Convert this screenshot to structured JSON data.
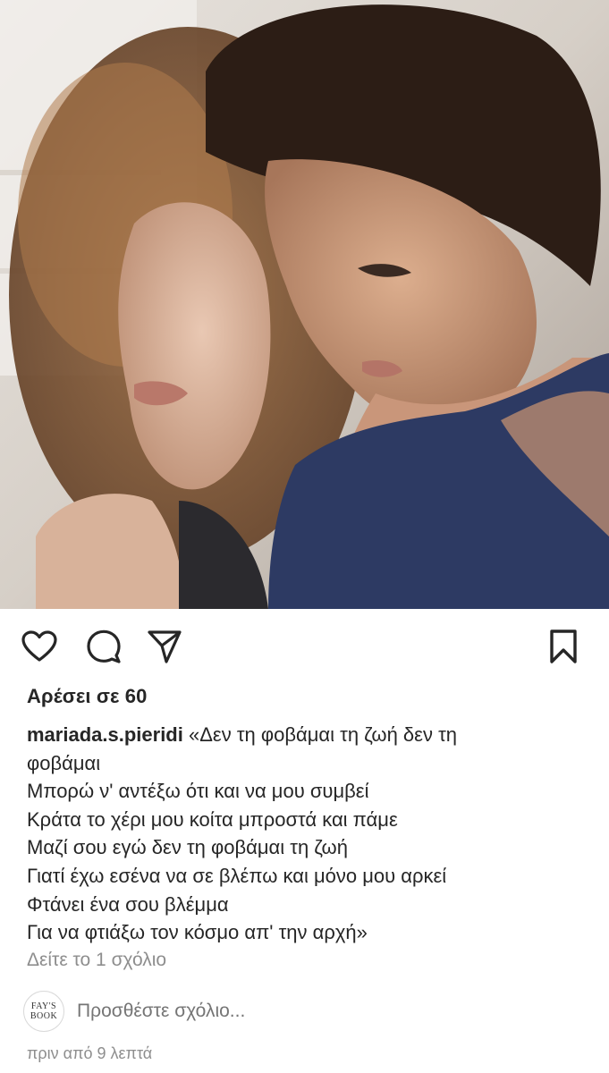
{
  "post": {
    "image_alt": "woman-and-boy-photo"
  },
  "actions": {
    "like_icon": "heart-icon",
    "comment_icon": "comment-bubble-icon",
    "share_icon": "paper-plane-icon",
    "save_icon": "bookmark-icon"
  },
  "likes": {
    "text": "Αρέσει σε 60"
  },
  "caption": {
    "username": "mariada.s.pieridi",
    "lines": [
      " «Δεν τη φοβάμαι τη ζωή δεν τη",
      "φοβάμαι",
      "Μπορώ ν' αντέξω ότι και να μου συμβεί",
      "Κράτα το χέρι μου κοίτα μπροστά και πάμε",
      "Μαζί σου εγώ δεν τη φοβάμαι τη ζωή",
      "Γιατί έχω εσένα να σε βλέπω και μόνο μου αρκεί",
      "Φτάνει ένα σου βλέμμα",
      "Για να φτιάξω τον κόσμο απ' την αρχή»"
    ]
  },
  "comments": {
    "view_all": "Δείτε το 1 σχόλιο",
    "add_placeholder": "Προσθέστε σχόλιο...",
    "avatar_text": {
      "line1": "FAY'S",
      "line2": "BOOK"
    }
  },
  "timestamp": "πριν από 9 λεπτά",
  "colors": {
    "text": "#262626",
    "muted": "#8e8e8e",
    "background": "#ffffff"
  }
}
